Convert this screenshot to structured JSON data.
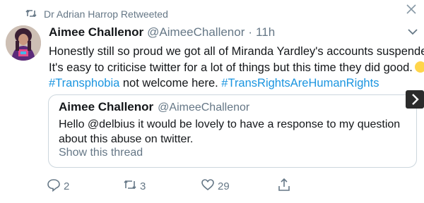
{
  "retweet_notice": {
    "text": "Dr Adrian Harrop Retweeted",
    "icon": "retweet-icon"
  },
  "tweet": {
    "author_name": "Aimee Challenor",
    "author_handle": "@AimeeChallenor",
    "separator": "·",
    "time": "11h",
    "text_line1": "Honestly still so proud we got all of Miranda Yardley's accounts suspended.",
    "text_line2": "It's easy to criticise twitter for a lot of things but this time they did good.",
    "hashtag1": "#Transphobia",
    "text_mid": " not welcome here. ",
    "hashtag2": "#TransRightsAreHumanRights",
    "emoji": "clapping-hands-emoji"
  },
  "quoted_tweet": {
    "author_name": "Aimee Challenor",
    "author_handle": "@AimeeChallenor",
    "text_line1": "Hello @delbius it would be lovely to have a response to my question",
    "text_line2": "about this abuse on twitter.",
    "show_thread": "Show this thread"
  },
  "actions": {
    "reply_count": "2",
    "retweet_count": "3",
    "like_count": "29"
  },
  "colors": {
    "link": "#1b95e0",
    "muted": "#657786",
    "text": "#14171a",
    "border": "#ccd6dd"
  },
  "icons": [
    "retweet-icon",
    "close-icon",
    "chevron-down-icon",
    "reply-icon",
    "like-icon",
    "share-icon",
    "next-arrow-icon"
  ]
}
